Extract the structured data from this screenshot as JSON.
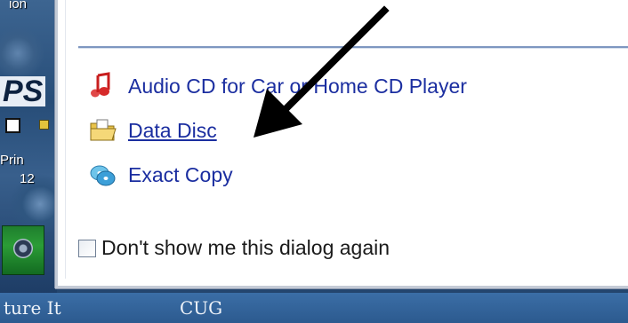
{
  "desktop": {
    "fragments": [
      "ion",
      "PS",
      "Prin",
      "12"
    ],
    "taskbar_labels": [
      "ture It",
      "CUG"
    ]
  },
  "dialog": {
    "options": [
      {
        "label": "Audio CD for Car or Home CD Player",
        "icon": "music-note-icon"
      },
      {
        "label": "Data Disc",
        "icon": "folder-icon"
      },
      {
        "label": "Exact Copy",
        "icon": "disc-copy-icon"
      }
    ],
    "dont_show_label": "Don't show me this dialog again",
    "dont_show_checked": false
  },
  "annotation": {
    "arrow_color": "#000000"
  }
}
